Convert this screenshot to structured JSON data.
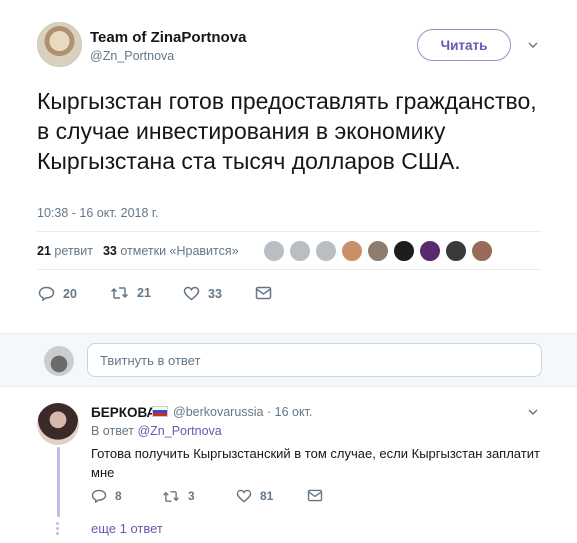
{
  "tweet": {
    "author_name": "Team of ZinaPortnova",
    "author_handle": "@Zn_Portnova",
    "follow_label": "Читать",
    "text": "Кыргызстан готов предоставлять гражданство, в случае инвестирования в экономику Кыргызстана ста тысяч долларов США.",
    "timestamp": "10:38 - 16 окт. 2018 г.",
    "retweets_count": "21",
    "retweets_label": "ретвит",
    "likes_count": "33",
    "likes_label": "отметки «Нравится»",
    "liker_colors": [
      "#b9bec3",
      "#b9bec3",
      "#b9bec3",
      "#c98e6a",
      "#8e7c6e",
      "#1d1d1d",
      "#5a2a6e",
      "#3a3a3a",
      "#9a6a5a"
    ],
    "actions": {
      "reply_count": "20",
      "retweet_count": "21",
      "like_count": "33"
    }
  },
  "reply_box": {
    "placeholder": "Твитнуть в ответ"
  },
  "reply": {
    "author_name": "БЕРКОВА",
    "author_handle": "@berkovarussia · 16 окт.",
    "in_reply_prefix": "В ответ",
    "in_reply_handle": "@Zn_Portnova",
    "text": "Готова получить Кыргызстанский в том случае, если Кыргызстан заплатит мне",
    "reply_count": "8",
    "retweet_count": "3",
    "like_count": "81",
    "more_replies": "еще 1 ответ"
  },
  "colors": {
    "accent": "#6a56b0",
    "muted": "#657786",
    "text": "#14171a"
  }
}
